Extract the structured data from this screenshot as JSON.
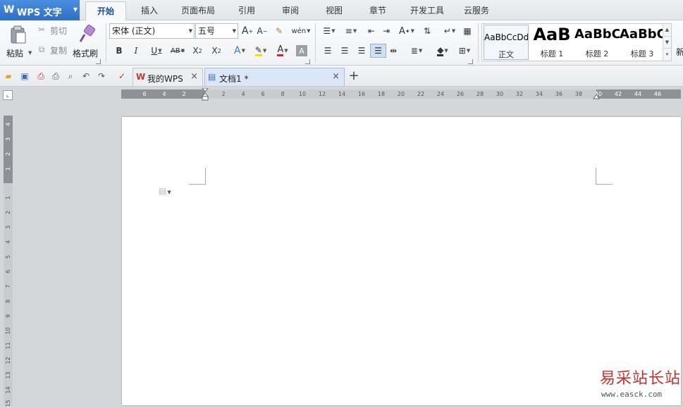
{
  "app": {
    "logo": "W",
    "name": "WPS 文字"
  },
  "menu": {
    "tabs": [
      {
        "label": "开始",
        "active": true
      },
      {
        "label": "插入"
      },
      {
        "label": "页面布局"
      },
      {
        "label": "引用"
      },
      {
        "label": "审阅"
      },
      {
        "label": "视图"
      },
      {
        "label": "章节"
      },
      {
        "label": "开发工具"
      },
      {
        "label": "云服务"
      }
    ]
  },
  "ribbon": {
    "clipboard": {
      "paste": "粘贴",
      "cut": "剪切",
      "copy": "复制",
      "format_painter": "格式刷"
    },
    "font": {
      "name": "宋体 (正文)",
      "size": "五号"
    },
    "styles": [
      {
        "preview": "AaBbCcDd",
        "name": "正文"
      },
      {
        "preview": "AaB",
        "name": "标题 1"
      },
      {
        "preview": "AaBbC",
        "name": "标题 2"
      },
      {
        "preview": "AaBbC",
        "name": "标题 3"
      }
    ],
    "more_styles_label": "新"
  },
  "quickbar": {
    "tabs": [
      {
        "label": "我的WPS",
        "active": false
      },
      {
        "label": "文档1 *",
        "active": true
      }
    ],
    "new_tab_symbol": "+"
  },
  "ruler": {
    "horizontal": [
      "6",
      "4",
      "2",
      "2",
      "4",
      "6",
      "8",
      "10",
      "12",
      "14",
      "16",
      "18",
      "20",
      "22",
      "24",
      "26",
      "28",
      "30",
      "32",
      "34",
      "36",
      "38",
      "40",
      "42",
      "44",
      "46"
    ],
    "vertical": [
      "4",
      "3",
      "2",
      "1",
      "1",
      "2",
      "3",
      "4",
      "5",
      "6",
      "7",
      "8",
      "9",
      "10",
      "11",
      "12",
      "13",
      "14",
      "15"
    ]
  },
  "watermark": {
    "title": "易采站长站",
    "url": "www.easck.com"
  },
  "colors": {
    "accent": "#2f6fc6",
    "active_tab_text": "#1c4f99",
    "font_color_bar": "#e02020",
    "highlight_bar": "#ffd800",
    "watermark": "#c9302c"
  }
}
